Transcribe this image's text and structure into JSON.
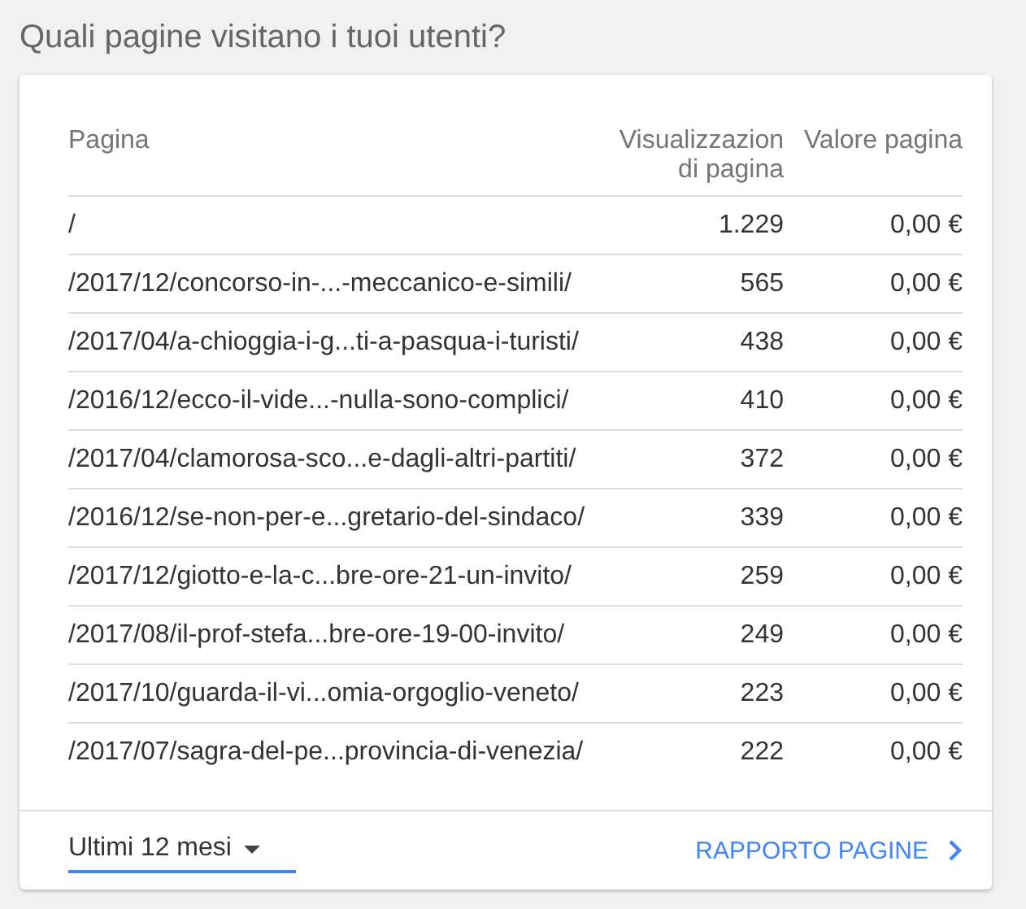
{
  "title": "Quali pagine visitano i tuoi utenti?",
  "table": {
    "columns": [
      "Pagina",
      "Visualizzazion di pagina",
      "Valore pagina"
    ],
    "rows": [
      {
        "page": "/",
        "views": "1.229",
        "value": "0,00 €"
      },
      {
        "page": "/2017/12/concorso-in-...-meccanico-e-simili/",
        "views": "565",
        "value": "0,00 €"
      },
      {
        "page": "/2017/04/a-chioggia-i-g...ti-a-pasqua-i-turisti/",
        "views": "438",
        "value": "0,00 €"
      },
      {
        "page": "/2016/12/ecco-il-vide...-nulla-sono-complici/",
        "views": "410",
        "value": "0,00 €"
      },
      {
        "page": "/2017/04/clamorosa-sco...e-dagli-altri-partiti/",
        "views": "372",
        "value": "0,00 €"
      },
      {
        "page": "/2016/12/se-non-per-e...gretario-del-sindaco/",
        "views": "339",
        "value": "0,00 €"
      },
      {
        "page": "/2017/12/giotto-e-la-c...bre-ore-21-un-invito/",
        "views": "259",
        "value": "0,00 €"
      },
      {
        "page": "/2017/08/il-prof-stefa...bre-ore-19-00-invito/",
        "views": "249",
        "value": "0,00 €"
      },
      {
        "page": "/2017/10/guarda-il-vi...omia-orgoglio-veneto/",
        "views": "223",
        "value": "0,00 €"
      },
      {
        "page": "/2017/07/sagra-del-pe...provincia-di-venezia/",
        "views": "222",
        "value": "0,00 €"
      }
    ]
  },
  "footer": {
    "range": "Ultimi 12 mesi",
    "link": "RAPPORTO PAGINE"
  }
}
